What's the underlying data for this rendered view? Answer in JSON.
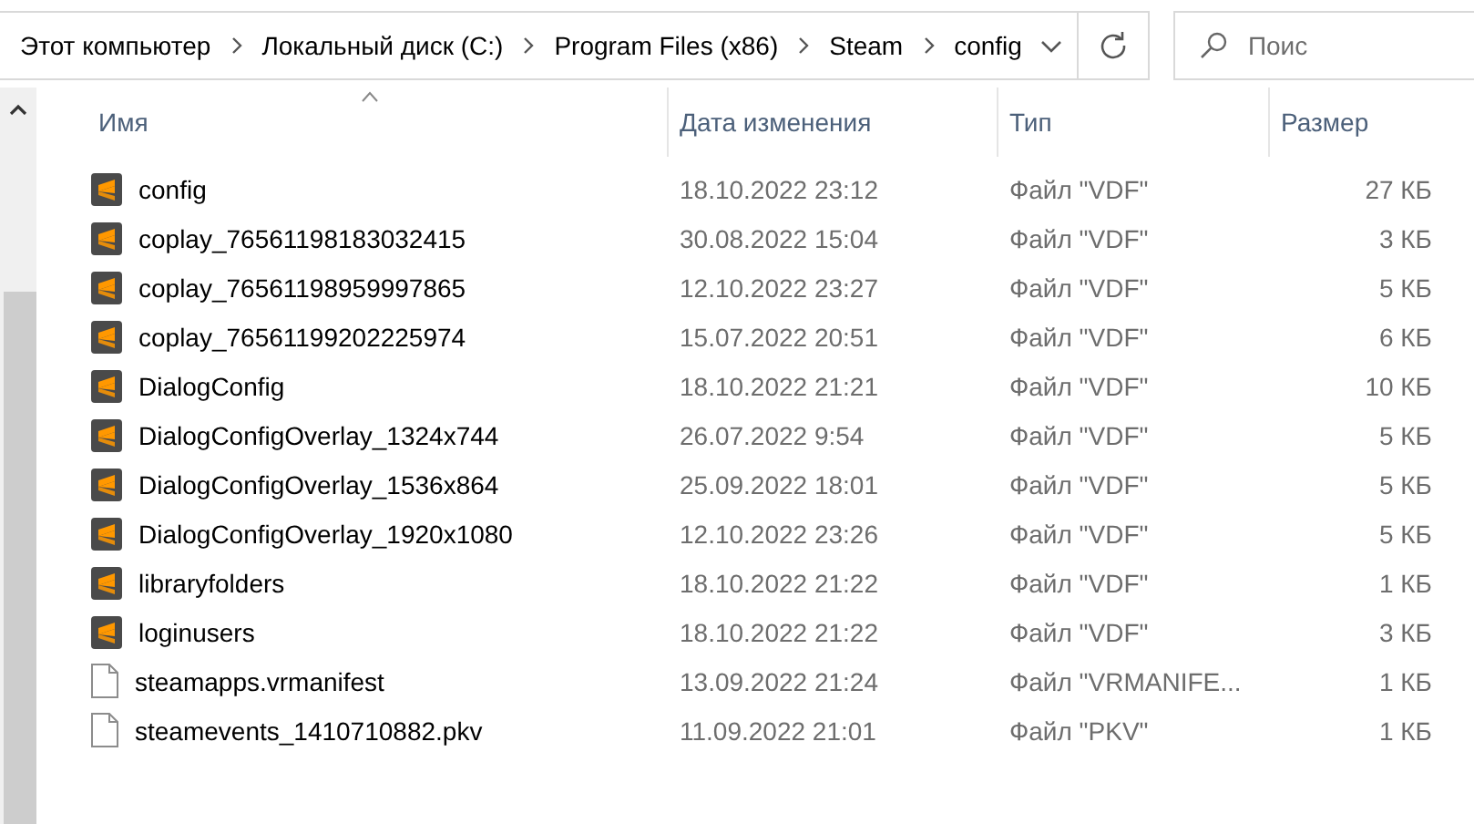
{
  "address_bar": {
    "path": [
      "Этот компьютер",
      "Локальный диск (C:)",
      "Program Files (x86)",
      "Steam",
      "config"
    ]
  },
  "search": {
    "placeholder": "Поис"
  },
  "columns": [
    {
      "label": "Имя",
      "sorted": true
    },
    {
      "label": "Дата изменения",
      "sorted": false
    },
    {
      "label": "Тип",
      "sorted": false
    },
    {
      "label": "Размер",
      "sorted": false
    }
  ],
  "files": [
    {
      "kind": "sublime",
      "name": "config",
      "date": "18.10.2022 23:12",
      "type": "Файл \"VDF\"",
      "size": "27 КБ"
    },
    {
      "kind": "sublime",
      "name": "coplay_76561198183032415",
      "date": "30.08.2022 15:04",
      "type": "Файл \"VDF\"",
      "size": "3 КБ"
    },
    {
      "kind": "sublime",
      "name": "coplay_76561198959997865",
      "date": "12.10.2022 23:27",
      "type": "Файл \"VDF\"",
      "size": "5 КБ"
    },
    {
      "kind": "sublime",
      "name": "coplay_76561199202225974",
      "date": "15.07.2022 20:51",
      "type": "Файл \"VDF\"",
      "size": "6 КБ"
    },
    {
      "kind": "sublime",
      "name": "DialogConfig",
      "date": "18.10.2022 21:21",
      "type": "Файл \"VDF\"",
      "size": "10 КБ"
    },
    {
      "kind": "sublime",
      "name": "DialogConfigOverlay_1324x744",
      "date": "26.07.2022 9:54",
      "type": "Файл \"VDF\"",
      "size": "5 КБ"
    },
    {
      "kind": "sublime",
      "name": "DialogConfigOverlay_1536x864",
      "date": "25.09.2022 18:01",
      "type": "Файл \"VDF\"",
      "size": "5 КБ"
    },
    {
      "kind": "sublime",
      "name": "DialogConfigOverlay_1920x1080",
      "date": "12.10.2022 23:26",
      "type": "Файл \"VDF\"",
      "size": "5 КБ"
    },
    {
      "kind": "sublime",
      "name": "libraryfolders",
      "date": "18.10.2022 21:22",
      "type": "Файл \"VDF\"",
      "size": "1 КБ"
    },
    {
      "kind": "sublime",
      "name": "loginusers",
      "date": "18.10.2022 21:22",
      "type": "Файл \"VDF\"",
      "size": "3 КБ"
    },
    {
      "kind": "plain",
      "name": "steamapps.vrmanifest",
      "date": "13.09.2022 21:24",
      "type": "Файл \"VRMANIFE...",
      "size": "1 КБ"
    },
    {
      "kind": "plain",
      "name": "steamevents_1410710882.pkv",
      "date": "11.09.2022 21:01",
      "type": "Файл \"PKV\"",
      "size": "1 КБ"
    }
  ]
}
